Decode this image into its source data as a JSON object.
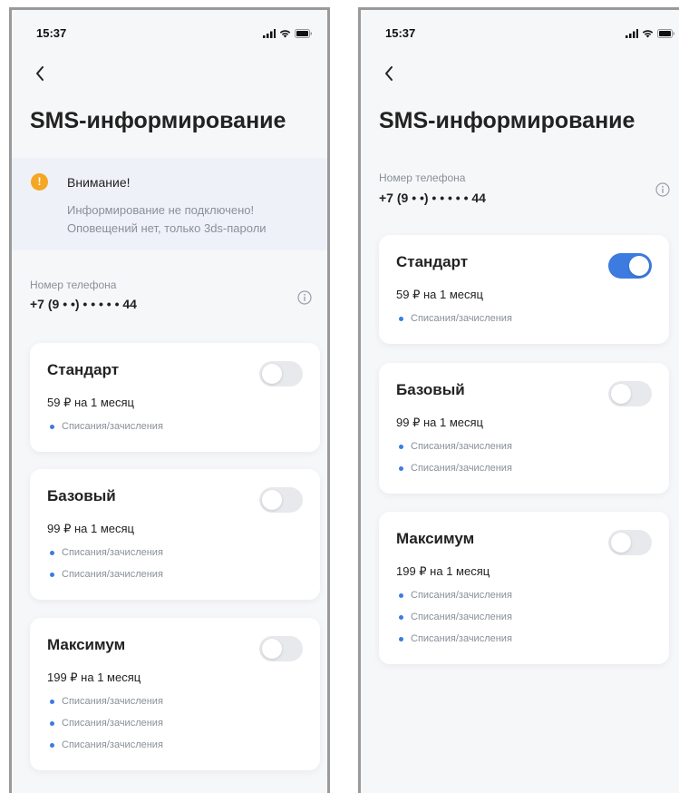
{
  "screens": [
    {
      "status_time": "15:37",
      "title": "SMS-информирование",
      "alert": {
        "title": "Внимание!",
        "line1": "Информирование не подключено!",
        "line2": "Оповещений нет, только 3ds-пароли",
        "icon": "exclamation-icon",
        "icon_glyph": "!"
      },
      "phone_label": "Номер телефона",
      "phone_value": "+7 (9 • •) • • • • • 44",
      "plans": [
        {
          "name": "Стандарт",
          "price": "59 ₽ на 1 месяц",
          "enabled": false,
          "features": [
            "Списания/зачисления"
          ]
        },
        {
          "name": "Базовый",
          "price": "99 ₽ на 1 месяц",
          "enabled": false,
          "features": [
            "Списания/зачисления",
            "Списания/зачисления"
          ]
        },
        {
          "name": "Максимум",
          "price": "199 ₽ на 1 месяц",
          "enabled": false,
          "features": [
            "Списания/зачисления",
            "Списания/зачисления",
            "Списания/зачисления"
          ]
        }
      ]
    },
    {
      "status_time": "15:37",
      "title": "SMS-информирование",
      "phone_label": "Номер телефона",
      "phone_value": "+7 (9 • •) • • • • • 44",
      "plans": [
        {
          "name": "Стандарт",
          "price": "59 ₽ на 1 месяц",
          "enabled": true,
          "features": [
            "Списания/зачисления"
          ]
        },
        {
          "name": "Базовый",
          "price": "99 ₽ на 1 месяц",
          "enabled": false,
          "features": [
            "Списания/зачисления",
            "Списания/зачисления"
          ]
        },
        {
          "name": "Максимум",
          "price": "199 ₽ на 1 месяц",
          "enabled": false,
          "features": [
            "Списания/зачисления",
            "Списания/зачисления",
            "Списания/зачисления"
          ]
        }
      ]
    }
  ],
  "colors": {
    "accent": "#3d7be0",
    "warning": "#f5a623",
    "alert_bg": "#eef2f8",
    "muted_text": "#8a8f99"
  },
  "icons": [
    "signal-icon",
    "wifi-icon",
    "battery-icon",
    "chevron-left-icon",
    "info-icon",
    "exclamation-icon"
  ]
}
